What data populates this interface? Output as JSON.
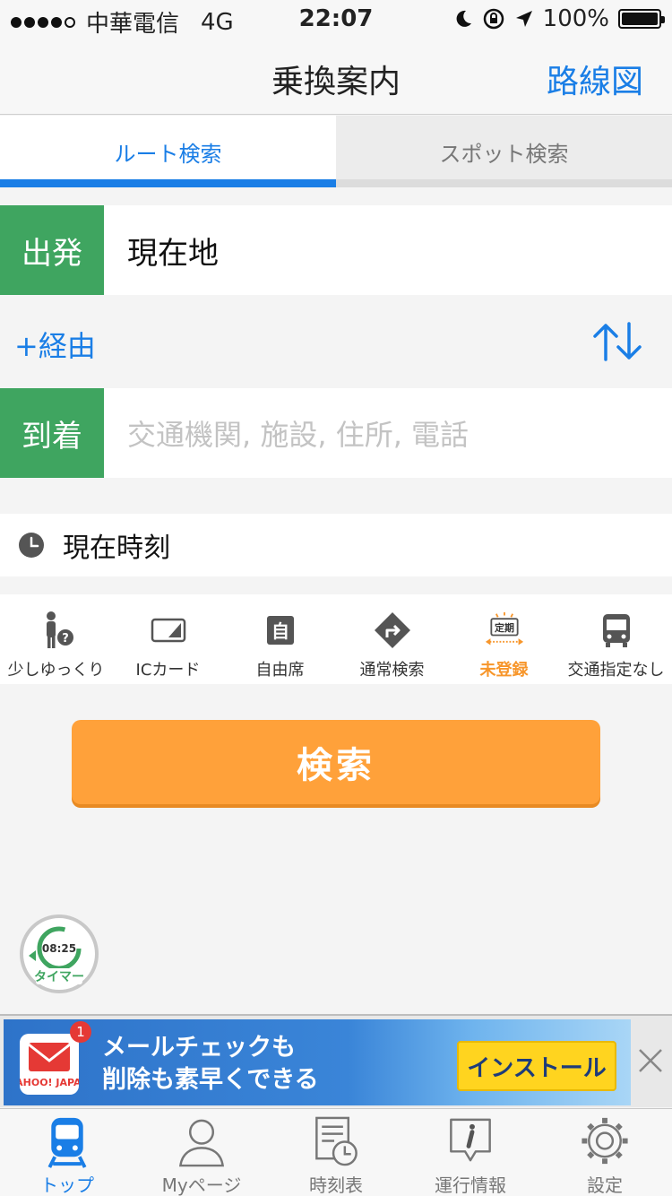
{
  "status_bar": {
    "carrier": "中華電信",
    "network": "4G",
    "time": "22:07",
    "battery": "100%"
  },
  "nav": {
    "title": "乗換案内",
    "route_map": "路線図"
  },
  "tabs": [
    {
      "label": "ルート検索",
      "active": true
    },
    {
      "label": "スポット検索",
      "active": false
    }
  ],
  "departure": {
    "label": "出発",
    "value": "現在地"
  },
  "via": {
    "label": "+経由"
  },
  "arrival": {
    "label": "到着",
    "placeholder": "交通機関, 施設, 住所, 電話"
  },
  "time": {
    "label": "現在時刻"
  },
  "options": [
    {
      "label": "少しゆっくり",
      "icon": "walking-person-icon"
    },
    {
      "label": "ICカード",
      "icon": "ic-card-icon"
    },
    {
      "label": "自由席",
      "icon": "seat-icon"
    },
    {
      "label": "通常検索",
      "icon": "route-diamond-icon"
    },
    {
      "label": "未登録",
      "icon": "commuter-pass-icon",
      "badge": "定期"
    },
    {
      "label": "交通指定なし",
      "icon": "bus-icon"
    }
  ],
  "search_button": {
    "label": "検索"
  },
  "timer": {
    "time": "08:25",
    "label": "タイマー"
  },
  "ad": {
    "line1": "メールチェックも",
    "line2": "削除も素早くできる",
    "install": "インストール",
    "badge": "1",
    "brand": "YAHOO! JAPAN"
  },
  "tabbar": [
    {
      "label": "トップ",
      "icon": "train-icon",
      "active": true
    },
    {
      "label": "Myページ",
      "icon": "user-icon",
      "active": false
    },
    {
      "label": "時刻表",
      "icon": "timetable-icon",
      "active": false
    },
    {
      "label": "運行情報",
      "icon": "info-icon",
      "active": false
    },
    {
      "label": "設定",
      "icon": "gear-icon",
      "active": false
    }
  ],
  "colors": {
    "accent": "#1a7ee6",
    "green": "#3fa560",
    "orange": "#ffa13a"
  }
}
